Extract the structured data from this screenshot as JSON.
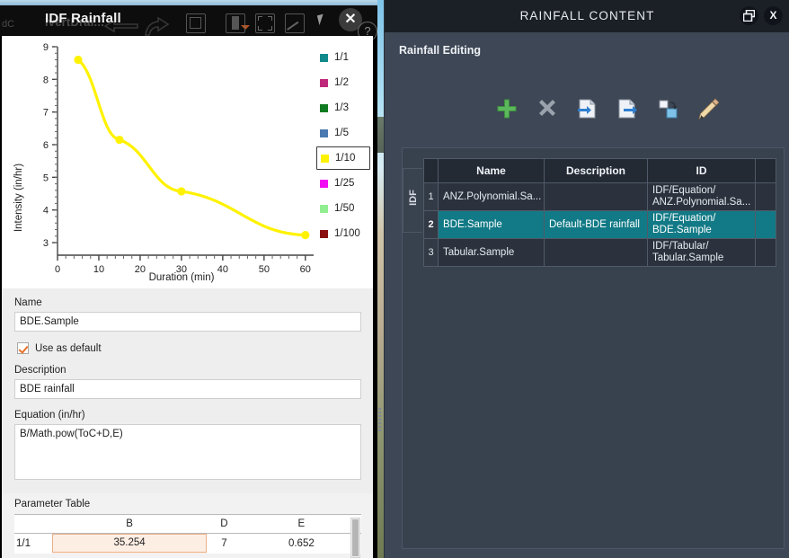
{
  "background": {
    "name": "site-photo-backdrop"
  },
  "left_window": {
    "title": "IDF Rainfall",
    "title_behind": "IvertDrai...",
    "title_behind_left": "dC",
    "toolbar_icons": [
      {
        "name": "back-arrow-icon"
      },
      {
        "name": "forward-arrow-icon"
      },
      {
        "name": "copy-window-icon"
      },
      {
        "name": "book-icon"
      },
      {
        "name": "fullscreen-icon"
      },
      {
        "name": "edit-shape-icon"
      },
      {
        "name": "pointer-icon"
      }
    ],
    "close_label": "✕",
    "help_label": "?",
    "form": {
      "name_label": "Name",
      "name_value": "BDE.Sample",
      "name_placeholder": "",
      "use_as_default_label": "Use as default",
      "use_as_default_checked": true,
      "description_label": "Description",
      "description_value": "BDE rainfall",
      "description_placeholder": "",
      "equation_label": "Equation (in/hr)",
      "equation_value": "B/Math.pow(ToC+D,E)",
      "equation_placeholder": ""
    },
    "parameter_table": {
      "title": "Parameter Table",
      "columns": [
        "",
        "B",
        "D",
        "E"
      ],
      "rows": [
        {
          "label": "1/1",
          "B": "35.254",
          "D": "7",
          "E": "0.652"
        }
      ]
    }
  },
  "chart_data": {
    "type": "line",
    "title": "",
    "xlabel": "Duration (min)",
    "ylabel": "Intensity (in/hr)",
    "xlim": [
      0,
      62
    ],
    "ylim": [
      3,
      9
    ],
    "xticks": [
      0,
      10,
      20,
      30,
      40,
      50,
      60
    ],
    "yticks": [
      3,
      4,
      5,
      6,
      7,
      8,
      9
    ],
    "grid": false,
    "legend_position": "right",
    "active_series": "1/10",
    "series": [
      {
        "name": "1/1",
        "color": "#108a8a",
        "visible": false,
        "x": [],
        "y": []
      },
      {
        "name": "1/2",
        "color": "#c0297a",
        "visible": false,
        "x": [],
        "y": []
      },
      {
        "name": "1/3",
        "color": "#107a20",
        "visible": false,
        "x": [],
        "y": []
      },
      {
        "name": "1/5",
        "color": "#4a7ab0",
        "visible": false,
        "x": [],
        "y": []
      },
      {
        "name": "1/10",
        "color": "#fff200",
        "visible": true,
        "x": [
          5,
          15,
          30,
          60
        ],
        "y": [
          8.6,
          6.15,
          4.57,
          3.23
        ]
      },
      {
        "name": "1/25",
        "color": "#f20cf2",
        "visible": false,
        "x": [],
        "y": []
      },
      {
        "name": "1/50",
        "color": "#90ee90",
        "visible": false,
        "x": [],
        "y": []
      },
      {
        "name": "1/100",
        "color": "#8a1010",
        "visible": false,
        "x": [],
        "y": []
      }
    ]
  },
  "right_window": {
    "title": "RAINFALL CONTENT",
    "restore_label": "❐",
    "close_label": "X",
    "section_title": "Rainfall Editing",
    "toolbar": [
      {
        "name": "add-icon",
        "label": "Add"
      },
      {
        "name": "delete-icon",
        "label": "Delete"
      },
      {
        "name": "import-icon",
        "label": "Import"
      },
      {
        "name": "export-icon",
        "label": "Export"
      },
      {
        "name": "duplicate-icon",
        "label": "Duplicate"
      },
      {
        "name": "edit-pencil-icon",
        "label": "Edit"
      }
    ],
    "tab_label": "IDF",
    "table": {
      "columns": [
        "",
        "Name",
        "Description",
        "ID",
        ""
      ],
      "rows": [
        {
          "num": "1",
          "name": "ANZ.Polynomial.Sa...",
          "description": "",
          "id_line1": "IDF/Equation/",
          "id_line2": "ANZ.Polynomial.Sa...",
          "selected": false
        },
        {
          "num": "2",
          "name": "BDE.Sample",
          "description": "Default-BDE rainfall",
          "id_line1": "IDF/Equation/",
          "id_line2": "BDE.Sample",
          "selected": true
        },
        {
          "num": "3",
          "name": "Tabular.Sample",
          "description": "",
          "id_line1": "IDF/Tabular/",
          "id_line2": "Tabular.Sample",
          "selected": false
        }
      ]
    }
  },
  "colors": {
    "selection_teal": "#127a86",
    "accent_orange": "#e8722a",
    "panel_dark": "#3e4755",
    "titlebar_dark": "#1b2027"
  }
}
